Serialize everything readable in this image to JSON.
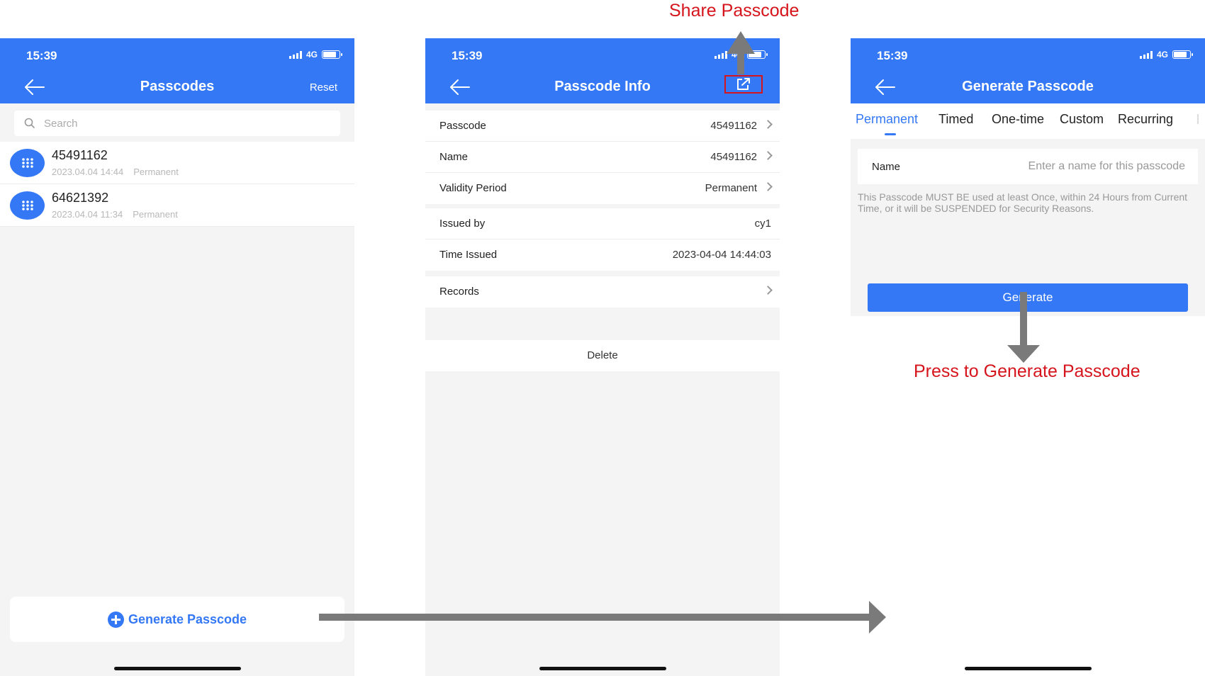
{
  "status": {
    "time": "15:39",
    "network": "4G"
  },
  "screen1": {
    "title": "Passcodes",
    "reset_label": "Reset",
    "search_placeholder": "Search",
    "items": [
      {
        "code": "45491162",
        "date": "2023.04.04 14:44",
        "type": "Permanent"
      },
      {
        "code": "64621392",
        "date": "2023.04.04 11:34",
        "type": "Permanent"
      }
    ],
    "generate_label": "Generate Passcode"
  },
  "screen2": {
    "title": "Passcode Info",
    "group1": [
      {
        "label": "Passcode",
        "value": "45491162"
      },
      {
        "label": "Name",
        "value": "45491162"
      },
      {
        "label": "Validity Period",
        "value": "Permanent"
      }
    ],
    "group2": [
      {
        "label": "Issued by",
        "value": "cy1"
      },
      {
        "label": "Time Issued",
        "value": "2023-04-04 14:44:03"
      }
    ],
    "records_label": "Records",
    "delete_label": "Delete"
  },
  "screen3": {
    "title": "Generate Passcode",
    "tabs": [
      "Permanent",
      "Timed",
      "One-time",
      "Custom",
      "Recurring"
    ],
    "name_label": "Name",
    "name_placeholder": "Enter a name for this passcode",
    "notice": "This Passcode MUST BE used at least Once, within 24 Hours from Current Time, or it will be SUSPENDED for Security Reasons.",
    "generate_button": "Generate"
  },
  "annotations": {
    "share": "Share Passcode",
    "press": "Press to Generate Passcode"
  },
  "colors": {
    "primary": "#3478f6",
    "annotation": "#d6141c",
    "arrow": "#7a7a7a"
  }
}
